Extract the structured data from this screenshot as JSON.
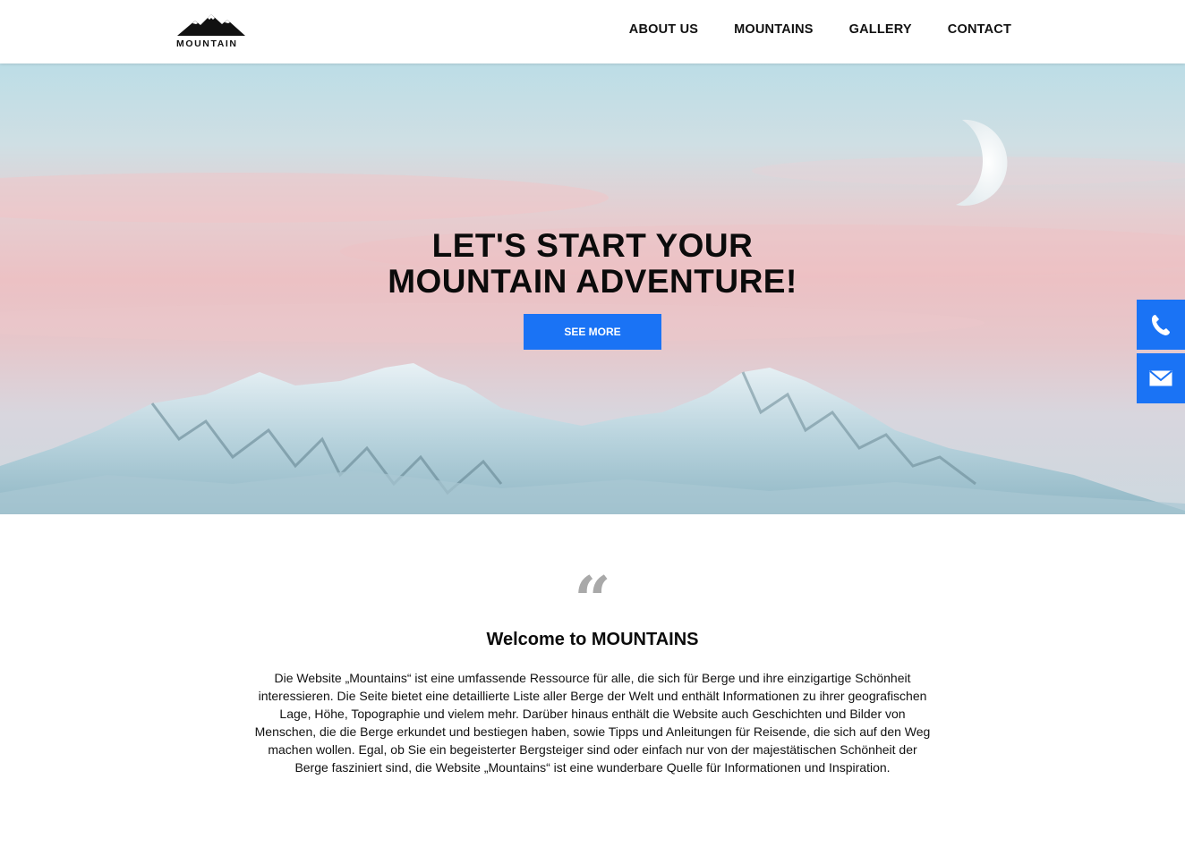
{
  "header": {
    "logo_text": "MOUNTAIN",
    "nav": [
      {
        "label": "ABOUT US"
      },
      {
        "label": "MOUNTAINS"
      },
      {
        "label": "GALLERY"
      },
      {
        "label": "CONTACT"
      }
    ]
  },
  "hero": {
    "title_line1": "LET'S START YOUR",
    "title_line2": "MOUNTAIN ADVENTURE!",
    "button_label": "SEE MORE"
  },
  "side_buttons": {
    "phone_icon": "phone-icon",
    "mail_icon": "mail-icon"
  },
  "welcome": {
    "quote_mark": "“",
    "title": "Welcome to MOUNTAINS",
    "text": "Die Website „Mountains“ ist eine umfassende Ressource für alle, die sich für Berge und ihre einzigartige Schönheit interessieren. Die Seite bietet eine detaillierte Liste aller Berge der Welt und enthält Informationen zu ihrer geografischen Lage, Höhe, Topographie und vielem mehr. Darüber hinaus enthält die Website auch Geschichten und Bilder von Menschen, die die Berge erkundet und bestiegen haben, sowie Tipps und Anleitungen für Reisende, die sich auf den Weg machen wollen. Egal, ob Sie ein begeisterter Bergsteiger sind oder einfach nur von der majestätischen Schönheit der Berge fasziniert sind, die Website „Mountains“ ist eine wunderbare Quelle für Informationen und Inspiration."
  },
  "colors": {
    "accent": "#1a73f5",
    "quote": "#a9a9a9"
  }
}
